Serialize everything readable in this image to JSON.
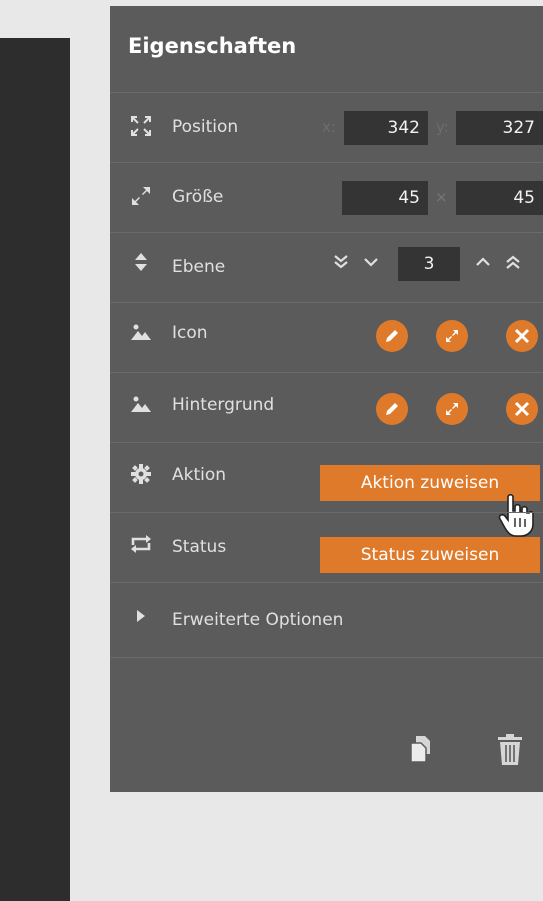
{
  "panel": {
    "title": "Eigenschaften"
  },
  "position": {
    "label": "Position",
    "x_label": "x:",
    "x_value": "342",
    "y_label": "y:",
    "y_value": "327"
  },
  "size": {
    "label": "Größe",
    "width_value": "45",
    "separator": "×",
    "height_value": "45"
  },
  "layer": {
    "label": "Ebene",
    "value": "3"
  },
  "icon_row": {
    "label": "Icon"
  },
  "background_row": {
    "label": "Hintergrund"
  },
  "action_row": {
    "label": "Aktion",
    "button_label": "Aktion zuweisen"
  },
  "status_row": {
    "label": "Status",
    "button_label": "Status zuweisen"
  },
  "advanced": {
    "label": "Erweiterte Optionen"
  },
  "colors": {
    "accent": "#e07a2b",
    "panel_bg": "#5b5b5b",
    "input_bg": "#343434"
  },
  "icons": {
    "position": "move-arrows-icon",
    "size": "resize-diagonal-icon",
    "layer": "sort-updown-icon",
    "image": "image-icon",
    "action": "gear-icon",
    "status": "repeat-icon",
    "expand": "triangle-right-icon",
    "copy": "copy-icon",
    "delete": "trash-icon"
  }
}
